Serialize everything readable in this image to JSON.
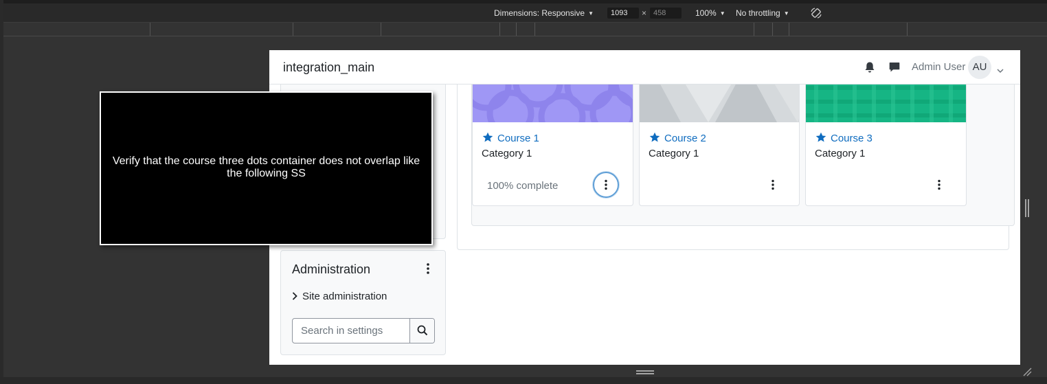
{
  "devtools": {
    "dimensions_label": "Dimensions: Responsive",
    "width_value": "1093",
    "times_symbol": "×",
    "height_placeholder": "458",
    "zoom_label": "100%",
    "throttling_label": "No throttling",
    "rotate_icon": "rotate-icon"
  },
  "header": {
    "site_name": "integration_main",
    "user_name": "Admin User",
    "avatar_initials": "AU"
  },
  "courses": [
    {
      "title": "Course 1",
      "category": "Category 1",
      "progress": "100% complete",
      "progress_percent": 100,
      "starred": true,
      "image_color": "#9f97f5"
    },
    {
      "title": "Course 2",
      "category": "Category 1",
      "progress": "",
      "starred": true,
      "image_color": "#d5d9dc"
    },
    {
      "title": "Course 3",
      "category": "Category 1",
      "progress": "",
      "starred": true,
      "image_color": "#16b584"
    }
  ],
  "admin_block": {
    "title": "Administration",
    "site_admin_label": "Site administration",
    "search_placeholder": "Search in settings"
  },
  "tooltip": {
    "text": "Verify that the course three dots container does not overlap like the following SS"
  },
  "colors": {
    "link": "#0f6cbf",
    "focus_ring": "#5e9ed6"
  }
}
